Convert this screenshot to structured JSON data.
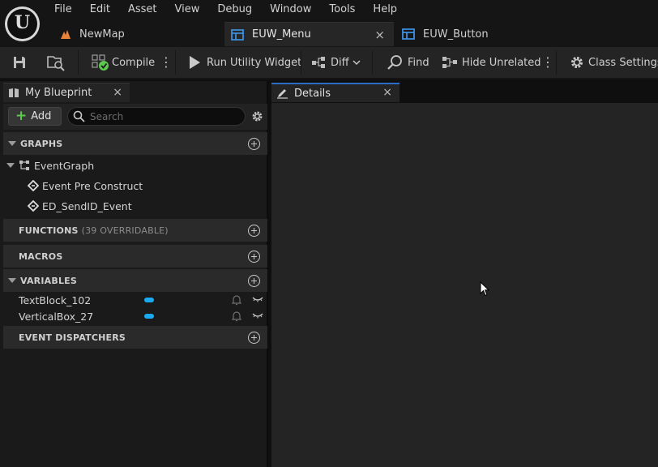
{
  "menu": [
    "File",
    "Edit",
    "Asset",
    "View",
    "Debug",
    "Window",
    "Tools",
    "Help"
  ],
  "doc_tabs": {
    "newmap": "NewMap",
    "euw_menu": "EUW_Menu",
    "euw_button": "EUW_Button",
    "close": "×"
  },
  "toolbar": {
    "compile": "Compile",
    "run_utility_widget": "Run Utility Widget",
    "diff": "Diff",
    "find": "Find",
    "hide_unrelated": "Hide Unrelated",
    "class_settings": "Class Settings"
  },
  "my_blueprint": {
    "tab_label": "My Blueprint",
    "add_label": "Add",
    "search_placeholder": "Search",
    "sections": {
      "graphs": "GRAPHS",
      "functions": "FUNCTIONS",
      "functions_sub": "(39 OVERRIDABLE)",
      "macros": "MACROS",
      "variables": "VARIABLES",
      "event_dispatchers": "EVENT DISPATCHERS"
    },
    "graph_items": {
      "event_graph": "EventGraph",
      "events": [
        "Event Pre Construct",
        "ED_SendID_Event"
      ]
    },
    "variables": [
      "TextBlock_102",
      "VerticalBox_27"
    ]
  },
  "details": {
    "tab_label": "Details"
  },
  "colors": {
    "accent_blue": "#2b6cc4",
    "variable_pill": "#1aa9f3",
    "compile_check": "#5ec94f",
    "newmap_icon": "#e8833a"
  }
}
